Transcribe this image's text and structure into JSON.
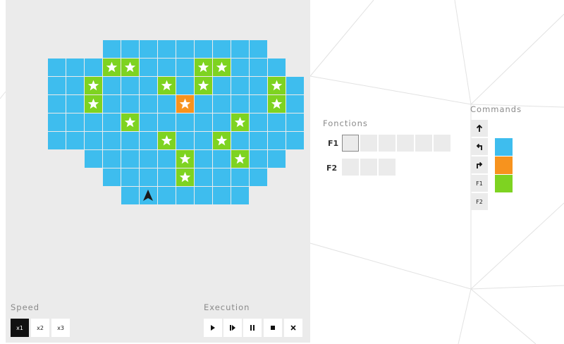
{
  "colors": {
    "blue": "#3ebdee",
    "green": "#7ed321",
    "orange": "#f7931e",
    "panel_bg": "#ebebeb"
  },
  "board": {
    "rows": [
      "...BBBBBBBBB..",
      "BBBGGBBBGGBBB.",
      "BBGBBBGBGBBBGB",
      "BBGBBBBOBBBBGB",
      "BBBBGBBBBBGBBB",
      "BBBBBBGBBGBBBB",
      "..BBBBBGBBGBB.",
      "...BBBBGBBBB..",
      "....BBBBBBB..."
    ],
    "robot": {
      "row": 8,
      "col": 5,
      "facing": "up"
    }
  },
  "speed": {
    "label": "Speed",
    "options": [
      "x1",
      "x2",
      "x3"
    ],
    "selected": "x1"
  },
  "execution": {
    "label": "Execution",
    "buttons": [
      "play",
      "step",
      "pause",
      "stop",
      "clear"
    ]
  },
  "functions": {
    "label": "Fonctions",
    "list": [
      {
        "name": "F1",
        "slots": 6
      },
      {
        "name": "F2",
        "slots": 3
      }
    ]
  },
  "commands": {
    "label": "Commands",
    "moves": [
      "forward",
      "turn-left",
      "turn-right"
    ],
    "calls": [
      "F1",
      "F2"
    ],
    "color_swatches": [
      "blue",
      "orange",
      "green"
    ]
  }
}
